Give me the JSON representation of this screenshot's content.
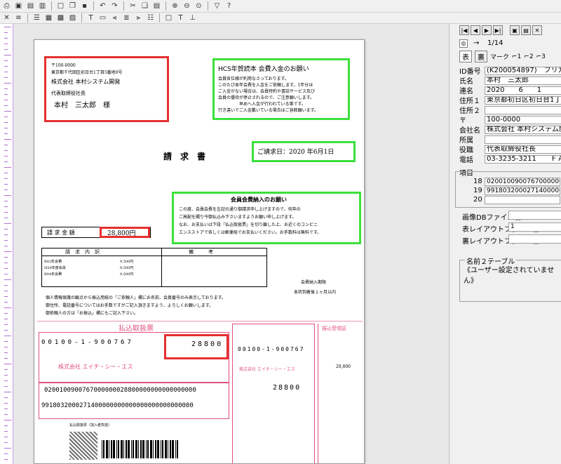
{
  "toolbar1": {
    "icons": [
      "print-icon",
      "print-preview-icon",
      "open-icon",
      "save-icon",
      "new-doc-icon",
      "copy-doc-icon",
      "save-disk-icon",
      "undo-icon",
      "redo-icon",
      "cut-icon",
      "copy-icon",
      "paste-icon",
      "zoom-in-icon",
      "zoom-out-icon",
      "zoom-fit-icon",
      "filter-icon",
      "help-icon"
    ]
  },
  "toolbar2": {
    "icons": [
      "select-icon",
      "align-icon",
      "list-icon",
      "table-icon",
      "grid-icon",
      "image-icon",
      "text-icon",
      "border-icon",
      "align-left-icon",
      "align-center-icon",
      "align-right-icon",
      "align-justify-icon",
      "frame-icon",
      "text-box-icon",
      "line-icon"
    ]
  },
  "document": {
    "postal_code": "〒100-0000",
    "address_line": "東京都千代田区初日台1丁目5番地0号",
    "company_name": "株式会社 本村システム開発",
    "title_line": "代表取締役社長",
    "recipient": "本村　三太郎　様",
    "notice1_title": "HCS年賀読本 会費入金のお願い",
    "notice1_lines": [
      "会員各位様が利用なさっております。",
      "このたび本年会費を入金をご依頼します。1年分ほ",
      "ご入金がない場合は、会員特約や書誌サービス及び",
      "会員の優待が停止されるので、ご注意願いします。",
      "　　　　　早めへ入金が行われている事です。",
      "行き違いでご入金戴いている場合はご容赦願います。"
    ],
    "doc_title": "請　求　書",
    "request_date": "ご請求日：2020 年6月1日",
    "notice2_title": "会員会費納入のお願い",
    "notice2_lines": [
      "この度、会員会費を左記の通り御請求申し上げますので、何卒の",
      "ご高配を賜り今御払込み下さいますようお願い申し上げます。",
      "なお、お支払いは下段「払込取扱票」を切り離した上、お近くのコンビニ",
      "エンスストアで各しくは郵便局でお支払いください。お手数料は無料です。"
    ],
    "amount_label": "請 求 金 額",
    "amount_value": "28,800円",
    "detail_header_left": "請　求　内　訳",
    "detail_header_right": "備　　　考",
    "detail_rows": [
      {
        "label": "R03年会費",
        "amount": "9,500円"
      },
      {
        "label": "H29年度会員",
        "amount": "9,500円"
      },
      {
        "label": "R04年会費",
        "amount": "9,500円"
      }
    ],
    "deadline_label": "会費納入期限",
    "deadline_value": "本状到着後１ヶ月以内",
    "note_lines": [
      "個人情報保護の観点から振込用紙の「ご依頼人」欄にお名前、会員番号のみ表示しております。",
      "御住所、電話番号についてはお手数ですがご記入頂きますよう、よろしくお願いします。",
      "御依頼人の方は「お振込」欄にもご記入下さい。"
    ],
    "slip_title": "払込取扱票",
    "slip_account": "00100-1-900767",
    "slip_amount": "28800",
    "slip_payee": "株式会社 エイチ・シー・エス",
    "slip_code1": "0200100900767000000028800000000000000000",
    "slip_code2": "9918032000271400000000000000000000000000",
    "receipt_title": "振込受領証",
    "receipt_amount": "28,800",
    "receipt_account": "00100-1-900767",
    "receipt_payee": "株式会社 エイチ・シー・エス",
    "barcode_label": "払込取扱票（加入者負担）"
  },
  "panel": {
    "nav_buttons": [
      "first-record-icon",
      "prev-record-icon",
      "next-record-icon",
      "last-record-icon",
      "toggle-view-icon",
      "save-record-icon",
      "close-icon"
    ],
    "record_counter": "1/14",
    "tabs": {
      "front": "表",
      "back": "裏",
      "mark": "マーク",
      "opt1": "1",
      "opt2": "2",
      "opt3": "3"
    },
    "fields": [
      {
        "label": "ID番号",
        "value": "(K200054897)　フリガナ"
      },
      {
        "label": "氏名",
        "value": "本村　三太郎"
      },
      {
        "label": "連名",
        "value": "2020　　6　　1"
      },
      {
        "label": "住所１",
        "value": "東京都初日区初日台1丁目"
      },
      {
        "label": "住所２",
        "value": ""
      },
      {
        "label": "〒",
        "value": "100-0000"
      },
      {
        "label": "会社名",
        "value": "株式会社 本村システム開"
      },
      {
        "label": "所属",
        "value": ""
      },
      {
        "label": "役職",
        "value": "代表取締役社長"
      },
      {
        "label": "電話",
        "value": "03-3235-3211　　ＦＡ"
      }
    ],
    "items_label": "項目",
    "items": [
      {
        "no": "18",
        "value": "02001009007670000002880"
      },
      {
        "no": "19",
        "value": "99180320002714000000000"
      },
      {
        "no": "20",
        "value": ""
      }
    ],
    "image_db_label": "画像DBファイル名",
    "front_layout_label": "表レイアウトファイル名",
    "front_layout_value": "1",
    "back_layout_label": "裏レイアウトファイル名",
    "name_table_label": "名前２テーブル",
    "name_table_value": "《ユーザー設定されていません》"
  }
}
